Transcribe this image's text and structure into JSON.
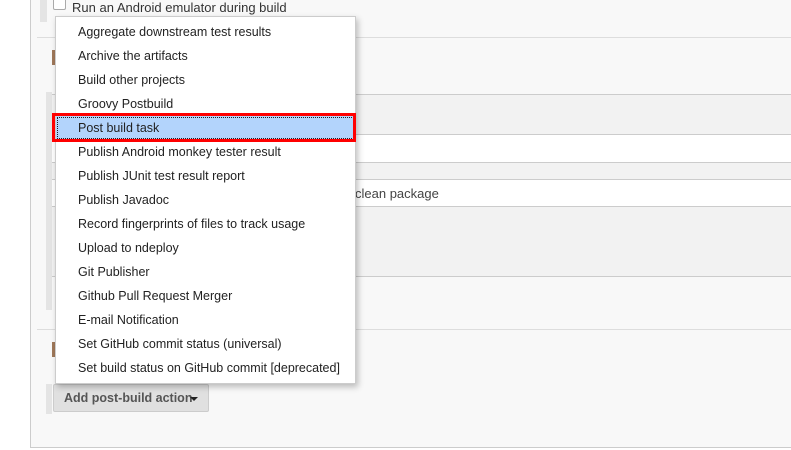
{
  "background": {
    "emulator_checkbox_label": "Run an Android emulator during build",
    "goals_value": "clean package"
  },
  "menu": {
    "items": [
      "Aggregate downstream test results",
      "Archive the artifacts",
      "Build other projects",
      "Groovy Postbuild",
      "Post build task",
      "Publish Android monkey tester result",
      "Publish JUnit test result report",
      "Publish Javadoc",
      "Record fingerprints of files to track usage",
      "Upload to ndeploy",
      "Git Publisher",
      "Github Pull Request Merger",
      "E-mail Notification",
      "Set GitHub commit status (universal)",
      "Set build status on GitHub commit [deprecated]"
    ],
    "selected": "Post build task",
    "highlight_color": "#ff0000"
  },
  "add_button": {
    "label": "Add post-build action",
    "icon": "caret-down-icon"
  }
}
